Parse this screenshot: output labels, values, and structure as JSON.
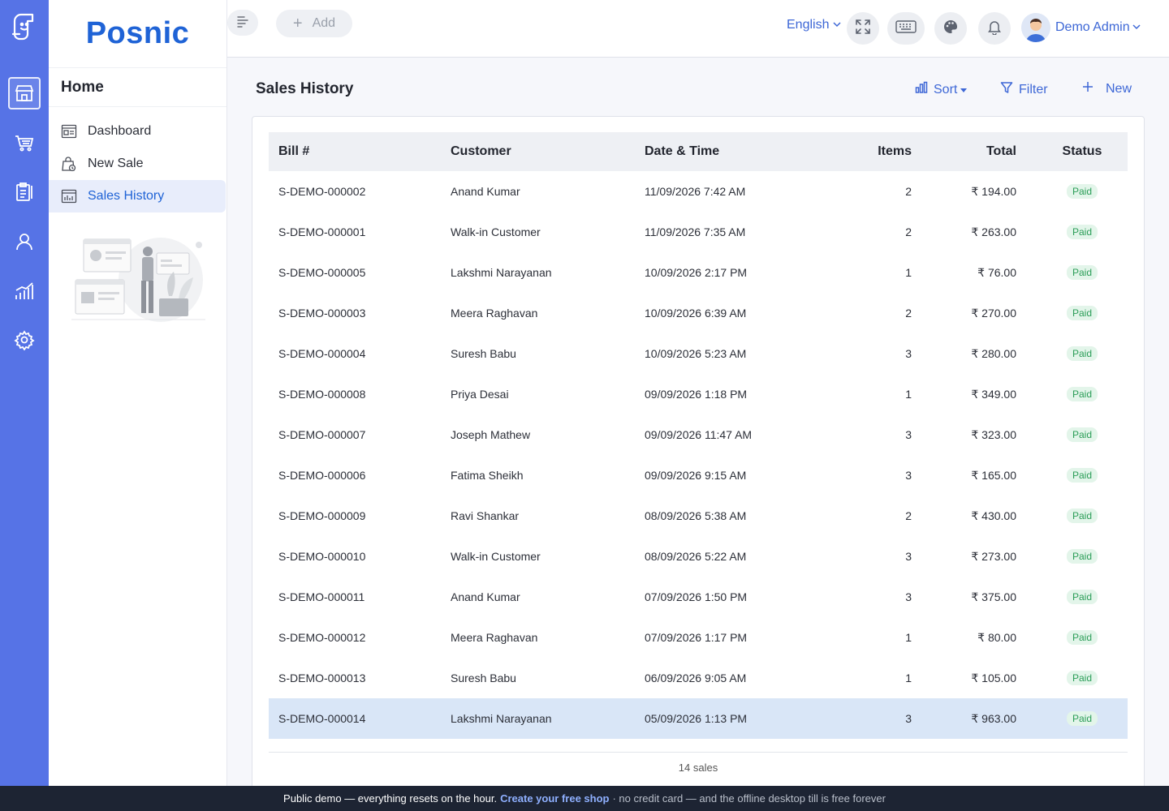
{
  "app": {
    "brand": "Posnic"
  },
  "rail": {
    "items": [
      {
        "icon": "store-icon"
      },
      {
        "icon": "cart-icon"
      },
      {
        "icon": "clipboard-icon"
      },
      {
        "icon": "user-icon"
      },
      {
        "icon": "chart-icon"
      },
      {
        "icon": "gear-icon"
      }
    ]
  },
  "sidebar": {
    "heading": "Home",
    "items": [
      {
        "label": "Dashboard",
        "icon": "dashboard-icon"
      },
      {
        "label": "New Sale",
        "icon": "bag-icon"
      },
      {
        "label": "Sales History",
        "icon": "history-icon"
      }
    ]
  },
  "header": {
    "add_label": "Add",
    "language": "English",
    "user_name": "Demo Admin"
  },
  "main": {
    "title": "Sales History",
    "actions": {
      "sort": "Sort",
      "filter": "Filter",
      "new": "New"
    },
    "columns": [
      "Bill #",
      "Customer",
      "Date & Time",
      "Items",
      "Total",
      "Status"
    ],
    "rows": [
      {
        "bill": "S-DEMO-000002",
        "customer": "Anand Kumar",
        "date": "11/09/2026 7:42 AM",
        "items": "2",
        "total": "₹ 194.00",
        "status": "Paid"
      },
      {
        "bill": "S-DEMO-000001",
        "customer": "Walk-in Customer",
        "date": "11/09/2026 7:35 AM",
        "items": "2",
        "total": "₹ 263.00",
        "status": "Paid"
      },
      {
        "bill": "S-DEMO-000005",
        "customer": "Lakshmi Narayanan",
        "date": "10/09/2026 2:17 PM",
        "items": "1",
        "total": "₹ 76.00",
        "status": "Paid"
      },
      {
        "bill": "S-DEMO-000003",
        "customer": "Meera Raghavan",
        "date": "10/09/2026 6:39 AM",
        "items": "2",
        "total": "₹ 270.00",
        "status": "Paid"
      },
      {
        "bill": "S-DEMO-000004",
        "customer": "Suresh Babu",
        "date": "10/09/2026 5:23 AM",
        "items": "3",
        "total": "₹ 280.00",
        "status": "Paid"
      },
      {
        "bill": "S-DEMO-000008",
        "customer": "Priya Desai",
        "date": "09/09/2026 1:18 PM",
        "items": "1",
        "total": "₹ 349.00",
        "status": "Paid"
      },
      {
        "bill": "S-DEMO-000007",
        "customer": "Joseph Mathew",
        "date": "09/09/2026 11:47 AM",
        "items": "3",
        "total": "₹ 323.00",
        "status": "Paid"
      },
      {
        "bill": "S-DEMO-000006",
        "customer": "Fatima Sheikh",
        "date": "09/09/2026 9:15 AM",
        "items": "3",
        "total": "₹ 165.00",
        "status": "Paid"
      },
      {
        "bill": "S-DEMO-000009",
        "customer": "Ravi Shankar",
        "date": "08/09/2026 5:38 AM",
        "items": "2",
        "total": "₹ 430.00",
        "status": "Paid"
      },
      {
        "bill": "S-DEMO-000010",
        "customer": "Walk-in Customer",
        "date": "08/09/2026 5:22 AM",
        "items": "3",
        "total": "₹ 273.00",
        "status": "Paid"
      },
      {
        "bill": "S-DEMO-000011",
        "customer": "Anand Kumar",
        "date": "07/09/2026 1:50 PM",
        "items": "3",
        "total": "₹ 375.00",
        "status": "Paid"
      },
      {
        "bill": "S-DEMO-000012",
        "customer": "Meera Raghavan",
        "date": "07/09/2026 1:17 PM",
        "items": "1",
        "total": "₹ 80.00",
        "status": "Paid"
      },
      {
        "bill": "S-DEMO-000013",
        "customer": "Suresh Babu",
        "date": "06/09/2026 9:05 AM",
        "items": "1",
        "total": "₹ 105.00",
        "status": "Paid"
      },
      {
        "bill": "S-DEMO-000014",
        "customer": "Lakshmi Narayanan",
        "date": "05/09/2026 1:13 PM",
        "items": "3",
        "total": "₹ 963.00",
        "status": "Paid",
        "selected": true
      }
    ],
    "count_label": "14 sales"
  },
  "banner": {
    "text_before": "Public demo — everything resets on the hour.",
    "link": "Create your free shop",
    "text_after": "· no credit card — and the offline desktop till is free forever"
  },
  "colors": {
    "rail": "#5673e6",
    "accent": "#1f63d6",
    "link": "#3d67d6",
    "paid_badge_bg": "#e3f5ea",
    "paid_badge_text": "#2a9d57",
    "selected_row": "#d9e6f7",
    "banner": "#1d2433"
  }
}
